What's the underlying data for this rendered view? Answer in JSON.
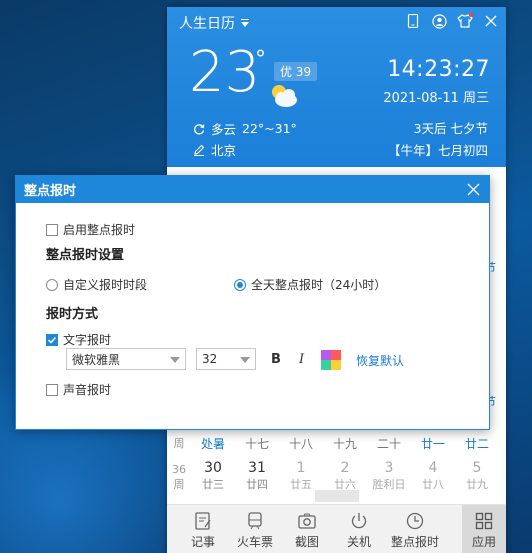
{
  "calendar": {
    "app_title": "人生日历",
    "temperature": "23",
    "degree": "°",
    "aqi": "优 39",
    "weather": "多云",
    "temp_range": "22°~31°",
    "city": "北京",
    "time": "14:23:27",
    "date": "2021-08-11 周三",
    "festival": "3天后 七夕节",
    "lunar": "【牛年】七月初四",
    "side_link_1": "节",
    "side_link_2": "节",
    "week_row": {
      "label": "周",
      "cells": [
        "处暑",
        "十七",
        "十八",
        "十九",
        "二十",
        "廿一",
        "廿二"
      ]
    },
    "day_row": {
      "week_no": "36",
      "label": "周",
      "days": [
        {
          "num": "30",
          "sub": "廿三"
        },
        {
          "num": "31",
          "sub": "廿四"
        },
        {
          "num": "1",
          "sub": "廿五"
        },
        {
          "num": "2",
          "sub": "廿六"
        },
        {
          "num": "3",
          "sub": "胜利日"
        },
        {
          "num": "4",
          "sub": "廿八"
        },
        {
          "num": "5",
          "sub": "廿九"
        }
      ]
    },
    "bottom_bar": [
      "记事",
      "火车票",
      "截图",
      "关机",
      "整点报时",
      "应用"
    ]
  },
  "dialog": {
    "title": "整点报时",
    "enable_label": "启用整点报时",
    "settings_heading": "整点报时设置",
    "radio_custom": "自定义报时时段",
    "radio_all_day": "全天整点报时（24小时）",
    "mode_heading": "报时方式",
    "text_mode": "文字报时",
    "font_value": "微软雅黑",
    "size_value": "32",
    "bold": "B",
    "italic": "I",
    "restore_link": "恢复默认",
    "voice_mode": "声音报时"
  },
  "colors": {
    "accent": "#1f87d9",
    "header": "#2a8ee2",
    "link": "#1a7bd6"
  }
}
